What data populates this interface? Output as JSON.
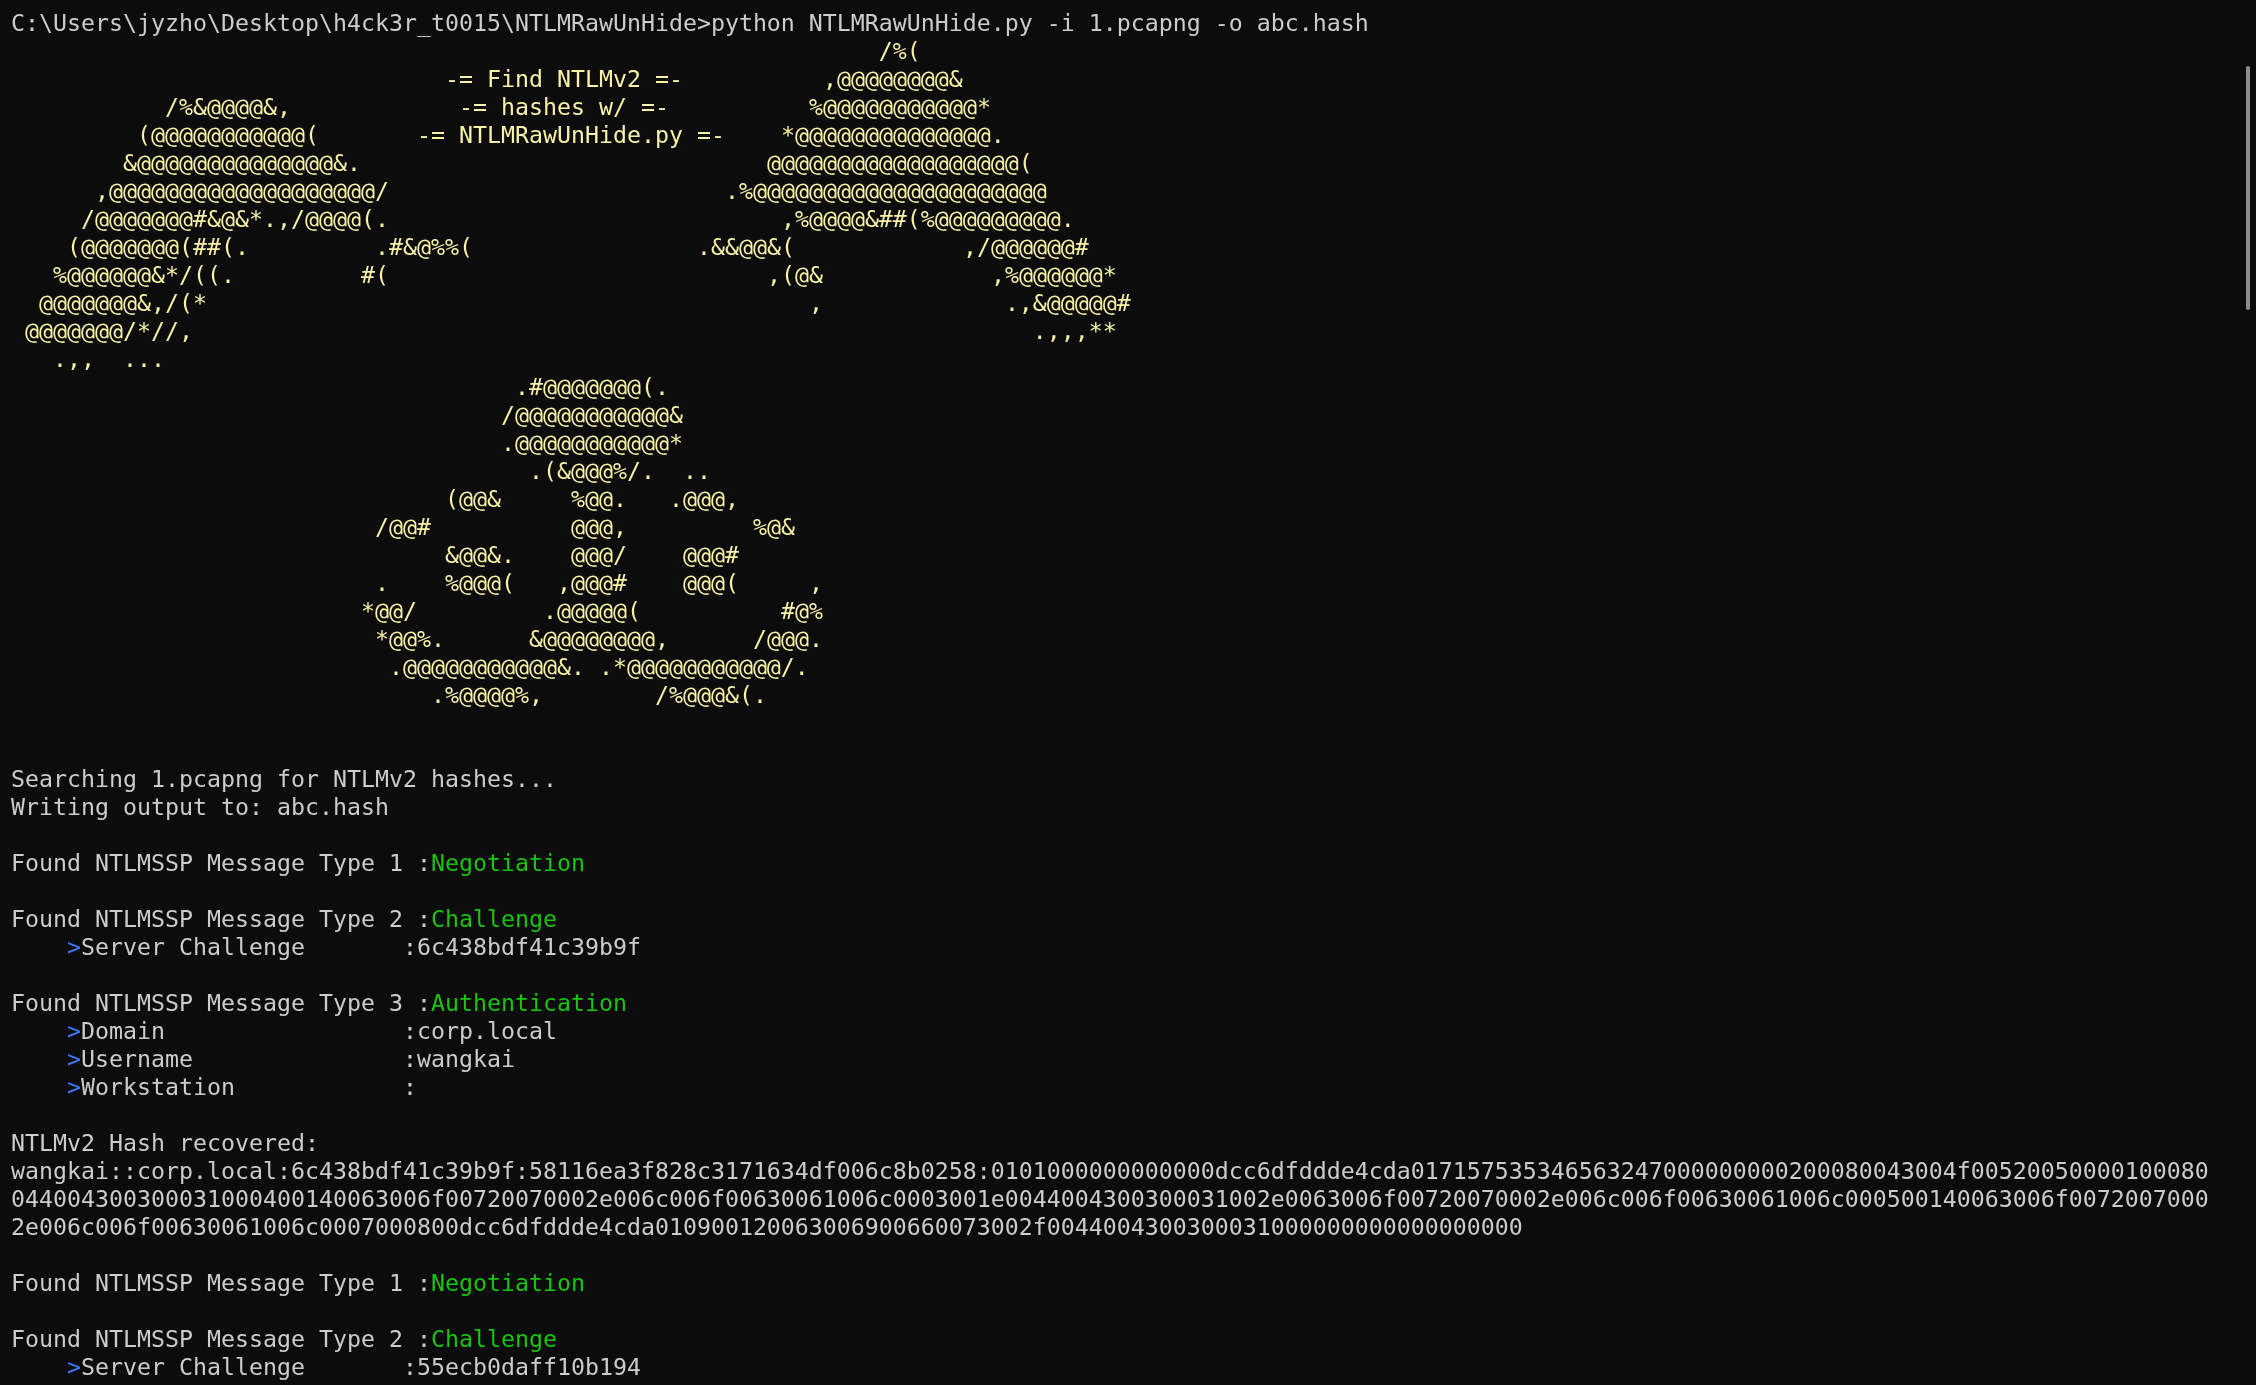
{
  "terminal": {
    "command_line": "C:\\Users\\jyzho\\Desktop\\h4ck3r_t0015\\NTLMRawUnHide>python NTLMRawUnHide.py -i 1.pcapng -o abc.hash",
    "ascii_art": [
      "                                                              /%(",
      "                               -= Find NTLMv2 =-          ,@@@@@@@@&",
      "           /%&@@@@&,            -= hashes w/ =-          %@@@@@@@@@@@*",
      "         (@@@@@@@@@@@(       -= NTLMRawUnHide.py =-    *@@@@@@@@@@@@@@.",
      "        &@@@@@@@@@@@@@@&.                             @@@@@@@@@@@@@@@@@@(",
      "      ,@@@@@@@@@@@@@@@@@@@/                        .%@@@@@@@@@@@@@@@@@@@@@",
      "     /@@@@@@@#&@&*.,/@@@@(.                            ,%@@@@&##(%@@@@@@@@@.",
      "    (@@@@@@@(##(.         .#&@%%(                .&&@@&(            ,/@@@@@@#",
      "   %@@@@@@&*/((.         #(                           ,(@&            ,%@@@@@@*",
      "  @@@@@@@&,/(*                                           ,             .,&@@@@@#",
      " @@@@@@@/*//,                                                            .,,,**",
      "   .,,  ...",
      "                                    .#@@@@@@@(.",
      "                                   /@@@@@@@@@@@&",
      "                                   .@@@@@@@@@@@*",
      "                                     .(&@@@%/.  ..",
      "                               (@@&     %@@.   .@@@,",
      "                          /@@#          @@@,         %@&",
      "                               &@@&.    @@@/    @@@#",
      "                          .    %@@@(   ,@@@#    @@@(     ,",
      "                         *@@/         .@@@@@(          #@%",
      "                          *@@%.      &@@@@@@@@,      /@@@.",
      "                           .@@@@@@@@@@@&. .*@@@@@@@@@@@/.",
      "                              .%@@@@%,        /%@@@&(."
    ],
    "status_lines": [
      "Searching 1.pcapng for NTLMv2 hashes...",
      "Writing output to: abc.hash"
    ],
    "blocks": [
      {
        "kind": "message",
        "heading": "Found NTLMSSP Message Type 1 :",
        "type_name": "Negotiation"
      },
      {
        "kind": "message",
        "heading": "Found NTLMSSP Message Type 2 :",
        "type_name": "Challenge",
        "fields": [
          {
            "marker": ">",
            "label": "Server Challenge",
            "separator": ":",
            "value": "6c438bdf41c39b9f"
          }
        ]
      },
      {
        "kind": "message",
        "heading": "Found NTLMSSP Message Type 3 :",
        "type_name": "Authentication",
        "fields": [
          {
            "marker": ">",
            "label": "Domain",
            "separator": ":",
            "value": "corp.local"
          },
          {
            "marker": ">",
            "label": "Username",
            "separator": ":",
            "value": "wangkai"
          },
          {
            "marker": ">",
            "label": "Workstation",
            "separator": ":"
          }
        ]
      },
      {
        "kind": "hash",
        "heading": "NTLMv2 Hash recovered:",
        "lines": [
          "wangkai::corp.local:6c438bdf41c39b9f:58116ea3f828c3171634df006c8b0258:0101000000000000dcc6dfddde4cda017157535346563247000000000200080043004f00520050000100080",
          "044004300300031000400140063006f00720070002e006c006f00630061006c0003001e0044004300300031002e0063006f00720070002e006c006f00630061006c000500140063006f0072007000",
          "2e006c006f00630061006c0007000800dcc6dfddde4cda010900120063006900660073002f0044004300300031000000000000000000"
        ]
      },
      {
        "kind": "message",
        "heading": "Found NTLMSSP Message Type 1 :",
        "type_name": "Negotiation"
      },
      {
        "kind": "message",
        "heading": "Found NTLMSSP Message Type 2 :",
        "type_name": "Challenge",
        "fields": [
          {
            "marker": ">",
            "label": "Server Challenge",
            "separator": ":",
            "value": "55ecb0daff10b194"
          }
        ]
      }
    ]
  }
}
